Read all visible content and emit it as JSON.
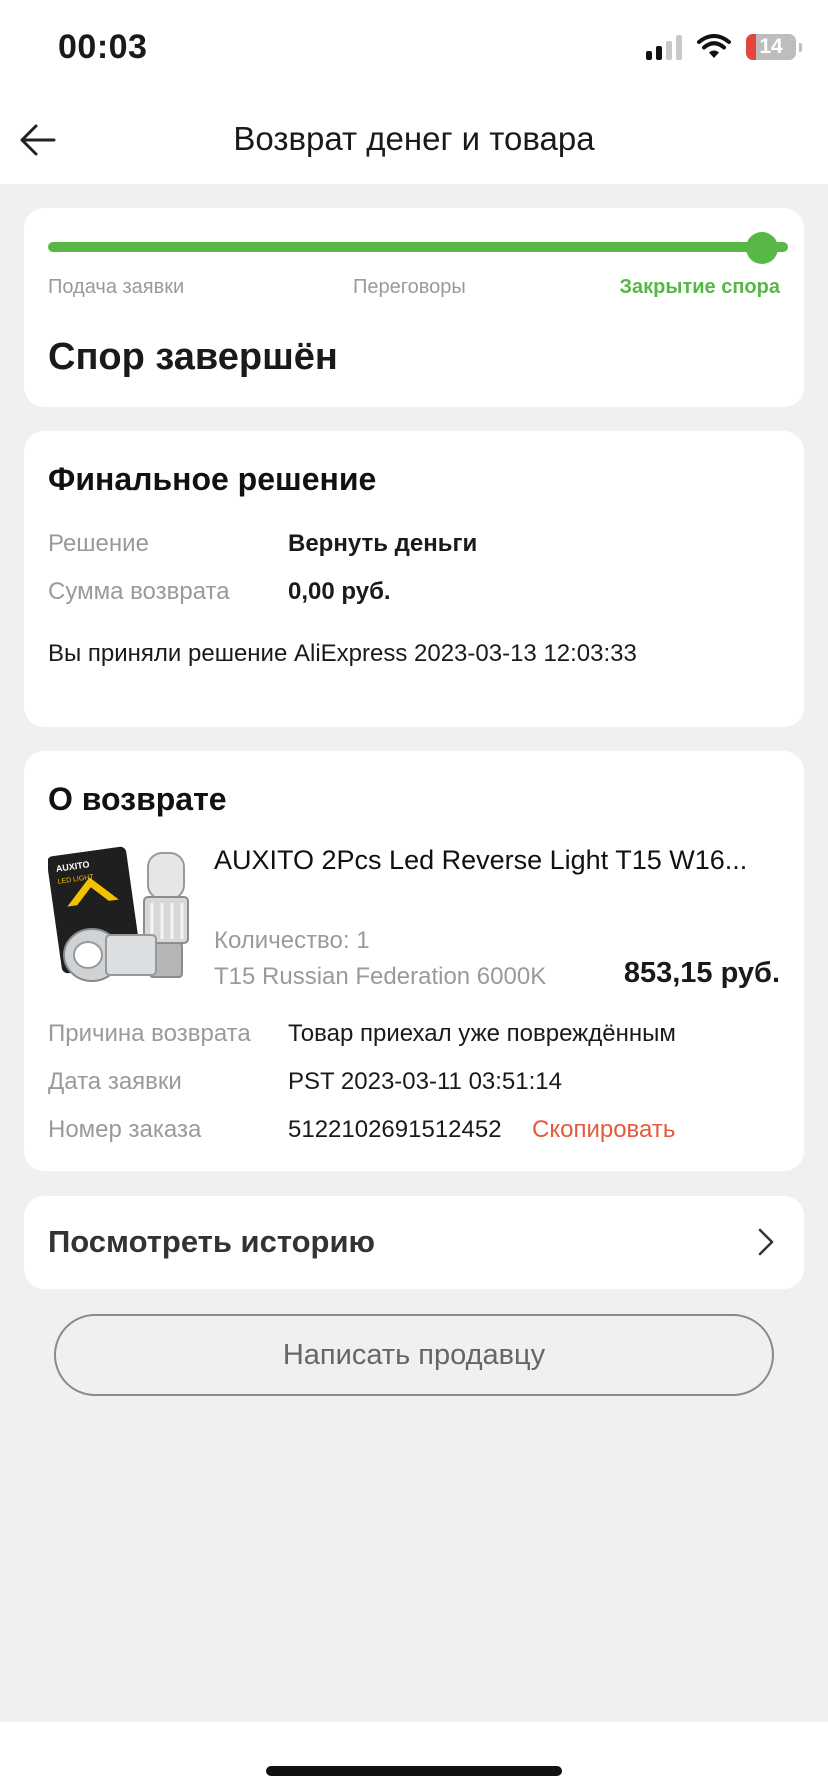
{
  "status_bar": {
    "time": "00:03",
    "battery": "14",
    "icons": [
      "signal-icon",
      "wifi-icon",
      "battery-icon"
    ]
  },
  "header": {
    "title": "Возврат денег и товара",
    "back_icon": "arrow-left-icon"
  },
  "progress": {
    "steps": [
      "Подача заявки",
      "Переговоры",
      "Закрытие спора"
    ],
    "current_step": 3,
    "progress_fraction": 1.0,
    "status": "Спор завершён",
    "accent_color": "#57b847"
  },
  "decision": {
    "title": "Финальное решение",
    "rows": [
      {
        "label": "Решение",
        "value": "Вернуть деньги"
      },
      {
        "label": "Сумма возврата",
        "value": "0,00 руб."
      }
    ],
    "note": "Вы приняли решение AliExpress 2023-03-13 12:03:33"
  },
  "return_info": {
    "title": "О возврате",
    "product": {
      "title": "AUXITO 2Pcs Led Reverse Light T15 W16...",
      "quantity": "Количество: 1",
      "variant": "T15 Russian Federation 6000K",
      "price": "853,15 руб.",
      "image_brand": "AUXITO",
      "image_caption": "LED LIGHT"
    },
    "rows": [
      {
        "label": "Причина возврата",
        "value": "Товар приехал уже повреждённым"
      },
      {
        "label": "Дата заявки",
        "value": "PST 2023-03-11 03:51:14"
      },
      {
        "label": "Номер заказа",
        "value": "5122102691512452"
      }
    ],
    "copy_label": "Скопировать",
    "copy_color": "#e35a3c"
  },
  "history": {
    "label": "Посмотреть историю",
    "icon": "chevron-right-icon"
  },
  "contact_button": {
    "label": "Написать продавцу"
  }
}
